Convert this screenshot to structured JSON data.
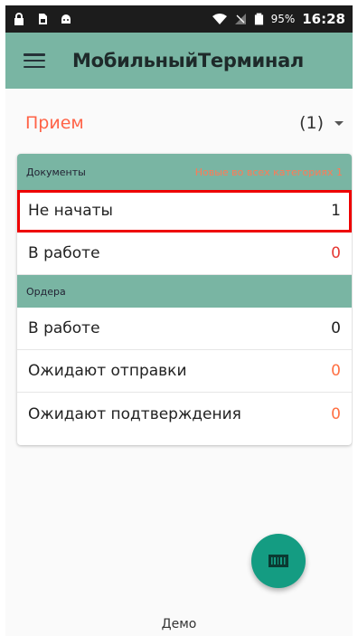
{
  "statusbar": {
    "battery_percent": "95%",
    "time": "16:28"
  },
  "toolbar": {
    "title": "МобильныйТерминал"
  },
  "section": {
    "name": "Прием",
    "count": "(1)"
  },
  "documents": {
    "title": "Документы",
    "note": "Новые во всех категориях 1",
    "rows": [
      {
        "label": "Не начаты",
        "value": "1",
        "value_color": "#222222",
        "highlighted": true
      },
      {
        "label": "В работе",
        "value": "0",
        "value_color": "#e53935",
        "highlighted": false
      }
    ]
  },
  "orders": {
    "title": "Ордера",
    "rows": [
      {
        "label": "В работе",
        "value": "0",
        "value_color": "#222222"
      },
      {
        "label": "Ожидают отправки",
        "value": "0",
        "value_color": "#ff7043"
      },
      {
        "label": "Ожидают подтверждения",
        "value": "0",
        "value_color": "#ff7043"
      }
    ]
  },
  "fab": {
    "icon": "barcode-scanner-icon"
  },
  "footer": {
    "text": "Демо"
  },
  "colors": {
    "toolbar": "#79b5a3",
    "accent_section": "#ff6347",
    "fab": "#149c82",
    "highlight": "#ee0000"
  }
}
